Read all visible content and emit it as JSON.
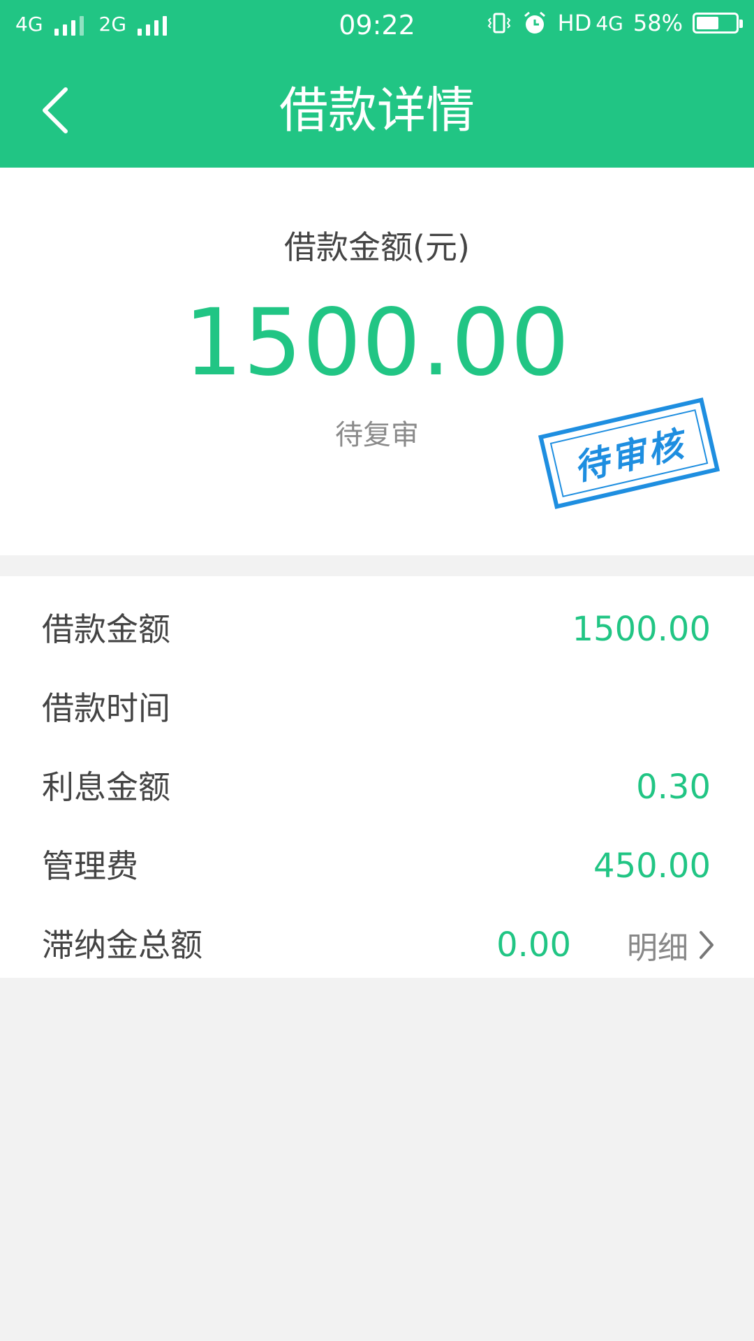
{
  "status_bar": {
    "network1": "4G",
    "network2": "2G",
    "time": "09:22",
    "data_type": "HD",
    "data_network": "4G",
    "battery_percent": "58%",
    "battery_level": 0.58,
    "icons": [
      "vibrate-icon",
      "alarm-icon",
      "battery-icon"
    ]
  },
  "nav": {
    "title": "借款详情",
    "back_icon": "chevron-left-icon"
  },
  "summary": {
    "label": "借款金额(元)",
    "amount": "1500.00",
    "status": "待复审",
    "stamp": "待审核"
  },
  "details": {
    "rows": [
      {
        "label": "借款金额",
        "value": "1500.00"
      },
      {
        "label": "借款时间",
        "value": ""
      },
      {
        "label": "利息金额",
        "value": "0.30"
      },
      {
        "label": "管理费",
        "value": "450.00"
      },
      {
        "label": "滞纳金总额",
        "value": "0.00",
        "link": "明细"
      }
    ]
  },
  "colors": {
    "primary": "#21c584",
    "background": "#f2f2f2",
    "stamp": "#1e8ee0"
  }
}
